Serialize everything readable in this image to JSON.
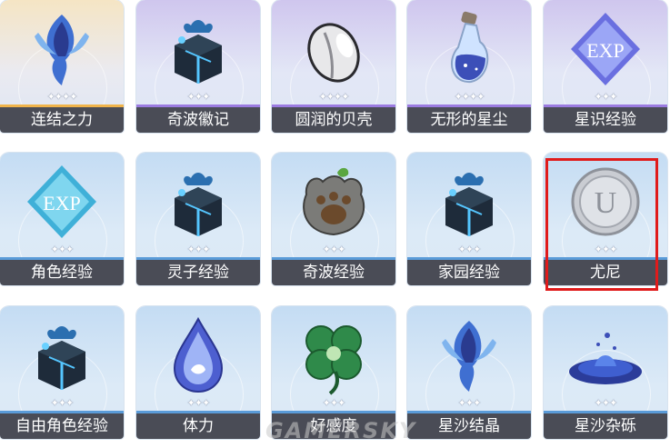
{
  "items": [
    {
      "label": "连结之力",
      "stars": "✦✦✦✦",
      "icon": "crystal-feather-icon",
      "rarity": 4,
      "stripe": "#f0b34a"
    },
    {
      "label": "奇波徽记",
      "stars": "✦✦✦",
      "icon": "gift-box-icon",
      "rarity": 4,
      "stripe": "#9b7be0"
    },
    {
      "label": "圆润的贝壳",
      "stars": "✦✦✦✦",
      "icon": "shell-icon",
      "rarity": 4,
      "stripe": "#9b7be0"
    },
    {
      "label": "无形的星尘",
      "stars": "✦✦✦✦",
      "icon": "stardust-bottle-icon",
      "rarity": 4,
      "stripe": "#9b7be0"
    },
    {
      "label": "星识经验",
      "stars": "✦✦✦",
      "icon": "exp-gem-purple-icon",
      "rarity": 4,
      "stripe": "#9b7be0"
    },
    {
      "label": "角色经验",
      "stars": "✦✦✦",
      "icon": "exp-gem-blue-icon",
      "rarity": 3,
      "stripe": "#5a9bd8"
    },
    {
      "label": "灵子经验",
      "stars": "✦✦✦",
      "icon": "gift-box-icon",
      "rarity": 3,
      "stripe": "#5a9bd8"
    },
    {
      "label": "奇波经验",
      "stars": "✦✦✦",
      "icon": "paw-stone-icon",
      "rarity": 3,
      "stripe": "#5a9bd8"
    },
    {
      "label": "家园经验",
      "stars": "✦✦✦",
      "icon": "gift-box-icon",
      "rarity": 3,
      "stripe": "#5a9bd8"
    },
    {
      "label": "尤尼",
      "stars": "✦✦✦",
      "icon": "coin-icon",
      "rarity": 3,
      "stripe": "#5a9bd8"
    },
    {
      "label": "自由角色经验",
      "stars": "✦✦✦",
      "icon": "gift-box-icon",
      "rarity": 3,
      "stripe": "#5a9bd8"
    },
    {
      "label": "体力",
      "stars": "✦✦✦",
      "icon": "water-drop-icon",
      "rarity": 3,
      "stripe": "#5a9bd8"
    },
    {
      "label": "好感度",
      "stars": "✦✦✦",
      "icon": "clover-icon",
      "rarity": 3,
      "stripe": "#5a9bd8"
    },
    {
      "label": "星沙结晶",
      "stars": "✦✦✦",
      "icon": "crystal-feather-icon",
      "rarity": 3,
      "stripe": "#5a9bd8"
    },
    {
      "label": "星沙杂砾",
      "stars": "✦✦✦",
      "icon": "star-sand-icon",
      "rarity": 3,
      "stripe": "#5a9bd8"
    }
  ],
  "highlight_color": "#e01b1b",
  "watermark": "GAMERSKY"
}
